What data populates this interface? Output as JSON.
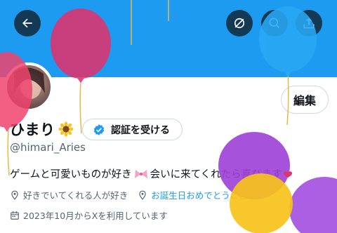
{
  "header": {
    "back_icon": "arrow-left-icon",
    "actions": [
      "no-sync-icon",
      "search-icon",
      "share-icon"
    ]
  },
  "profile": {
    "display_name": "ひまり",
    "name_emoji": "sunflower-icon",
    "verify_label": "認証を受ける",
    "edit_label": "編集",
    "handle": "@himari_Aries",
    "bio_part1": "ゲームと可愛いものが好き",
    "bio_part2": "会いに来てくれたら喜びます",
    "location": "好きでいてくれる人が好き",
    "website": "お誕生日おめでとうござ",
    "joined": "2023年10月からXを利用しています"
  },
  "colors": {
    "banner": "#1d9bf0",
    "verified_badge": "#1d9bf0",
    "balloons": [
      "#e0326d",
      "#29a8f5",
      "#9d3fd6",
      "#f6c21a",
      "#a24fe0",
      "#f0446d"
    ]
  }
}
